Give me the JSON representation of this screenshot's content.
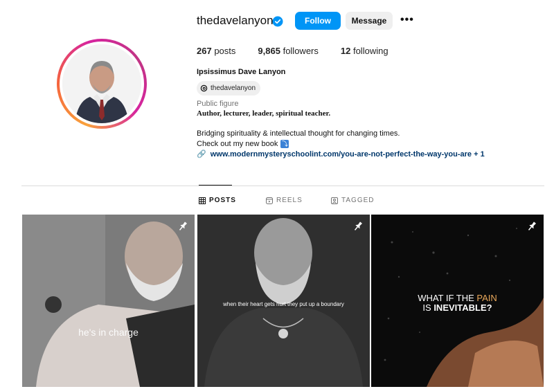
{
  "profile": {
    "username": "thedavelanyon",
    "verified": true,
    "follow_label": "Follow",
    "message_label": "Message",
    "more_label": "•••",
    "accent_color": "#0095f6"
  },
  "stats": {
    "posts": "267",
    "posts_label": "posts",
    "followers": "9,865",
    "followers_label": "followers",
    "following": "12",
    "following_label": "following"
  },
  "bio": {
    "full_name": "Ipsissimus Dave Lanyon",
    "threads_handle": "thedavelanyon",
    "category": "Public figure",
    "tagline": "Author, lecturer, leader, spiritual teacher.",
    "line1": "Bridging spirituality & intellectual thought for changing times.",
    "line2": "Check out my new book",
    "line2_emoji": "⤵",
    "link": "www.modernmysteryschoolint.com/you-are-not-perfect-the-way-you-are + 1"
  },
  "tabs": [
    {
      "label": "POSTS",
      "icon": "grid-icon",
      "active": true
    },
    {
      "label": "REELS",
      "icon": "reels-icon",
      "active": false
    },
    {
      "label": "TAGGED",
      "icon": "tagged-icon",
      "active": false
    }
  ],
  "posts": [
    {
      "caption": "he's in charge",
      "pinned": true
    },
    {
      "caption": "when their heart gets hurt they put up a boundary",
      "pinned": true
    },
    {
      "caption_part1": "WHAT IF THE ",
      "caption_highlight": "PAIN",
      "caption_part2": "IS ",
      "caption_bold": "INEVITABLE?",
      "pinned": true
    }
  ]
}
